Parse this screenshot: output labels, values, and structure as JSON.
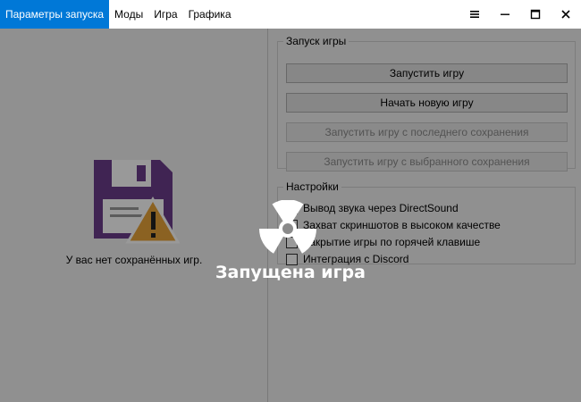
{
  "tabs": [
    {
      "label": "Параметры запуска",
      "active": true
    },
    {
      "label": "Моды",
      "active": false
    },
    {
      "label": "Игра",
      "active": false
    },
    {
      "label": "Графика",
      "active": false
    }
  ],
  "window_controls": [
    "menu-icon",
    "minimize-icon",
    "maximize-icon",
    "close-icon"
  ],
  "saves": {
    "empty_text": "У вас нет сохранённых игр.",
    "icon": "floppy-disk-warning-icon"
  },
  "launch_group": {
    "title": "Запуск игры",
    "buttons": [
      {
        "label": "Запустить игру",
        "enabled": true
      },
      {
        "label": "Начать новую игру",
        "enabled": true
      },
      {
        "label": "Запустить игру с последнего сохранения",
        "enabled": false
      },
      {
        "label": "Запустить игру с выбранного сохранения",
        "enabled": false
      }
    ]
  },
  "settings_group": {
    "title": "Настройки",
    "options": [
      {
        "label": "Вывод звука через DirectSound",
        "checked": false
      },
      {
        "label": "Захват скриншотов в высоком качестве",
        "checked": false
      },
      {
        "label": "Закрытие игры по горячей клавише",
        "checked": false
      },
      {
        "label": "Интеграция с Discord",
        "checked": false
      }
    ]
  },
  "overlay": {
    "text": "Запущена игра",
    "icon": "radiation-spinner-icon"
  },
  "colors": {
    "accent": "#0078d7",
    "floppy": "#6b3d8a",
    "warning": "#e8a33a"
  }
}
